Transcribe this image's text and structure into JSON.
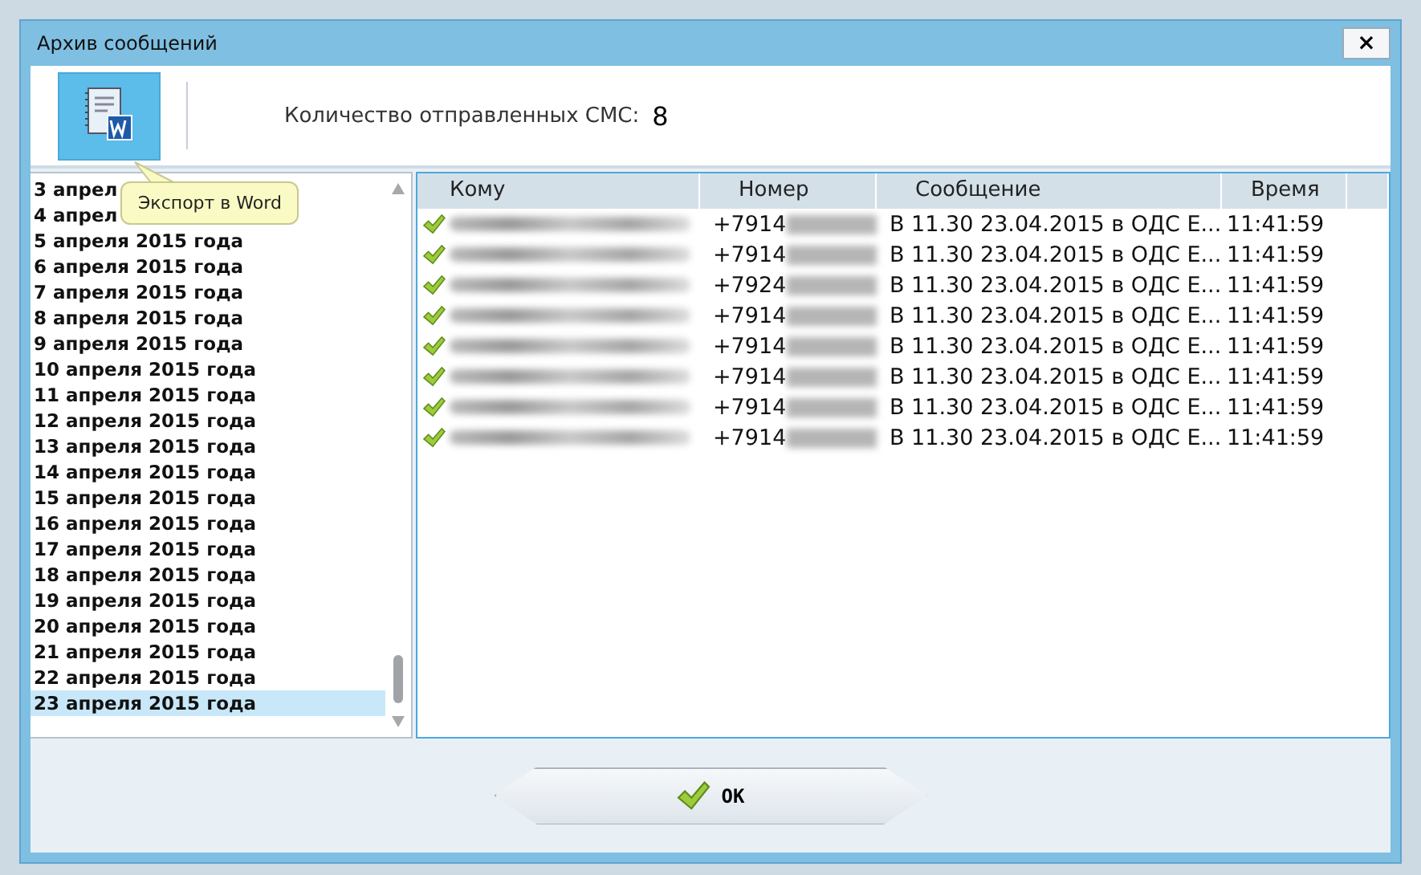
{
  "window": {
    "title": "Архив сообщений",
    "close": "×"
  },
  "toolbar": {
    "tooltip": "Экспорт в Word",
    "count_label": "Количество отправленных СМС:",
    "count": "8"
  },
  "dates": [
    {
      "label": "3 апрел",
      "selected": false
    },
    {
      "label": "4 апрел",
      "selected": false
    },
    {
      "label": "5 апреля 2015 года",
      "selected": false
    },
    {
      "label": "6 апреля 2015 года",
      "selected": false
    },
    {
      "label": "7 апреля 2015 года",
      "selected": false
    },
    {
      "label": "8 апреля 2015 года",
      "selected": false
    },
    {
      "label": "9 апреля 2015 года",
      "selected": false
    },
    {
      "label": "10 апреля 2015 года",
      "selected": false
    },
    {
      "label": "11 апреля 2015 года",
      "selected": false
    },
    {
      "label": "12 апреля 2015 года",
      "selected": false
    },
    {
      "label": "13 апреля 2015 года",
      "selected": false
    },
    {
      "label": "14 апреля 2015 года",
      "selected": false
    },
    {
      "label": "15 апреля 2015 года",
      "selected": false
    },
    {
      "label": "16 апреля 2015 года",
      "selected": false
    },
    {
      "label": "17 апреля 2015 года",
      "selected": false
    },
    {
      "label": "18 апреля 2015 года",
      "selected": false
    },
    {
      "label": "19 апреля 2015 года",
      "selected": false
    },
    {
      "label": "20 апреля 2015 года",
      "selected": false
    },
    {
      "label": "21 апреля 2015 года",
      "selected": false
    },
    {
      "label": "22 апреля 2015 года",
      "selected": false
    },
    {
      "label": "23 апреля 2015 года",
      "selected": true
    }
  ],
  "table": {
    "columns": [
      "Кому",
      "Номер",
      "Сообщение",
      "Время"
    ],
    "rows": [
      {
        "delivered": true,
        "number": "+7914",
        "message": "В 11.30 23.04.2015 в ОДС Е...",
        "time": "11:41:59"
      },
      {
        "delivered": true,
        "number": "+7914",
        "message": "В 11.30 23.04.2015 в ОДС Е...",
        "time": "11:41:59"
      },
      {
        "delivered": true,
        "number": "+7924",
        "message": "В 11.30 23.04.2015 в ОДС Е...",
        "time": "11:41:59"
      },
      {
        "delivered": true,
        "number": "+7914",
        "message": "В 11.30 23.04.2015 в ОДС Е...",
        "time": "11:41:59"
      },
      {
        "delivered": true,
        "number": "+7914",
        "message": "В 11.30 23.04.2015 в ОДС Е...",
        "time": "11:41:59"
      },
      {
        "delivered": true,
        "number": "+7914",
        "message": "В 11.30 23.04.2015 в ОДС Е...",
        "time": "11:41:59"
      },
      {
        "delivered": true,
        "number": "+7914",
        "message": "В 11.30 23.04.2015 в ОДС Е...",
        "time": "11:41:59"
      },
      {
        "delivered": true,
        "number": "+7914",
        "message": "В 11.30 23.04.2015 в ОДС Е...",
        "time": "11:41:59"
      }
    ]
  },
  "buttons": [
    {
      "label": "OK"
    }
  ]
}
